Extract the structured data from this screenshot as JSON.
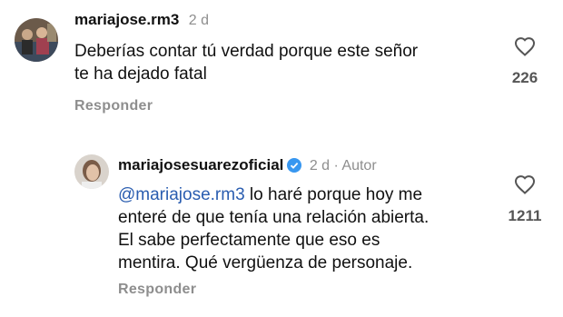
{
  "comment": {
    "username": "mariajose.rm3",
    "time": "2 d",
    "text_line1": "Deberías contar tú verdad porque este señor",
    "text_line2": "te ha dejado fatal",
    "likes": "226",
    "reply_label": "Responder"
  },
  "reply": {
    "username": "mariajosesuarezoficial",
    "time_author": "2 d · Autor",
    "mention": "@mariajose.rm3",
    "text_line1_rest": " lo haré porque hoy me",
    "text_line2": "enteré de que tenía una relación abierta.",
    "text_line3": "El sabe perfectamente que eso es",
    "text_line4": "mentira. Qué vergüenza de personaje.",
    "likes": "1211",
    "reply_label": "Responder"
  },
  "colors": {
    "mention": "#2a5db0",
    "verified": "#3897f0",
    "meta": "#8e8e8e"
  },
  "icons": [
    "heart-icon",
    "verified-badge-icon"
  ]
}
